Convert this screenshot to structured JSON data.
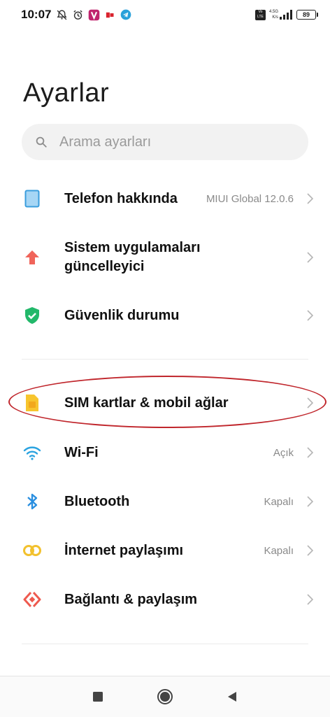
{
  "status_bar": {
    "time": "10:07",
    "net_speed_value": "4.5G",
    "net_speed_unit": "K/s",
    "volte_label": "Vo\nLTE",
    "battery": "89"
  },
  "page": {
    "title": "Ayarlar"
  },
  "search": {
    "placeholder": "Arama ayarları"
  },
  "settings_items": [
    {
      "label": "Telefon hakkında",
      "value": "MIUI Global 12.0.6",
      "icon": "phone-icon"
    },
    {
      "label": "Sistem uygulamaları\ngüncelleyici",
      "value": "",
      "icon": "update-arrow-icon"
    },
    {
      "label": "Güvenlik durumu",
      "value": "",
      "icon": "shield-check-icon"
    },
    {
      "label": "SIM kartlar & mobil ağlar",
      "value": "",
      "icon": "sim-card-icon"
    },
    {
      "label": "Wi-Fi",
      "value": "Açık",
      "icon": "wifi-icon"
    },
    {
      "label": "Bluetooth",
      "value": "Kapalı",
      "icon": "bluetooth-icon"
    },
    {
      "label": "İnternet paylaşımı",
      "value": "Kapalı",
      "icon": "hotspot-icon"
    },
    {
      "label": "Bağlantı & paylaşım",
      "value": "",
      "icon": "connection-sharing-icon"
    }
  ],
  "colors": {
    "highlight": "#c0262c",
    "wifi": "#2aa3e0",
    "bluetooth": "#2a8fe0",
    "shield": "#22b86a",
    "update": "#f0645a",
    "sim": "#f7c52e",
    "hotspot": "#f2c12e",
    "connection": "#ee5a4f",
    "phone": "#4aaee8"
  }
}
